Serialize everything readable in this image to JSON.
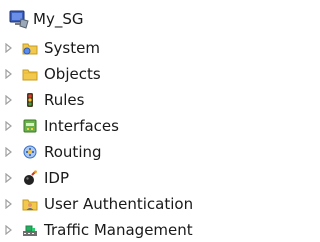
{
  "tree": {
    "root": {
      "label": "My_SG",
      "icon": "network-group-icon"
    },
    "items": [
      {
        "label": "System",
        "icon": "system-folder-icon"
      },
      {
        "label": "Objects",
        "icon": "objects-folder-icon"
      },
      {
        "label": "Rules",
        "icon": "rules-traffic-light-icon"
      },
      {
        "label": "Interfaces",
        "icon": "interfaces-icon"
      },
      {
        "label": "Routing",
        "icon": "routing-icon"
      },
      {
        "label": "IDP",
        "icon": "idp-icon"
      },
      {
        "label": "User Authentication",
        "icon": "user-authentication-icon"
      },
      {
        "label": "Traffic Management",
        "icon": "traffic-management-icon"
      }
    ]
  },
  "colors": {
    "expander": "#a0a0a0",
    "text": "#1a1a1a",
    "folder": "#f2c94c"
  }
}
